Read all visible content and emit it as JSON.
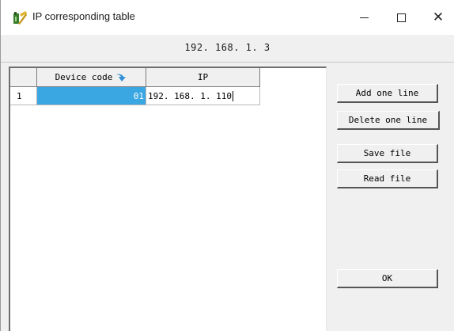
{
  "window": {
    "title": "IP corresponding table",
    "minimize_icon": "minimize-icon",
    "maximize_icon": "maximize-icon",
    "close_icon": "close-icon",
    "close_glyph": "✕"
  },
  "header": {
    "ip_text": "192. 168. 1. 3"
  },
  "table": {
    "columns": [
      "",
      "Device code",
      "IP"
    ],
    "rows": [
      {
        "index": "1",
        "device_code": "01",
        "ip": "192. 168. 1. 110"
      }
    ],
    "selected_color": "#3aa6e2"
  },
  "buttons": {
    "add": "Add one line",
    "delete": "Delete one line",
    "save": "Save file",
    "read": "Read file",
    "ok": "OK"
  }
}
